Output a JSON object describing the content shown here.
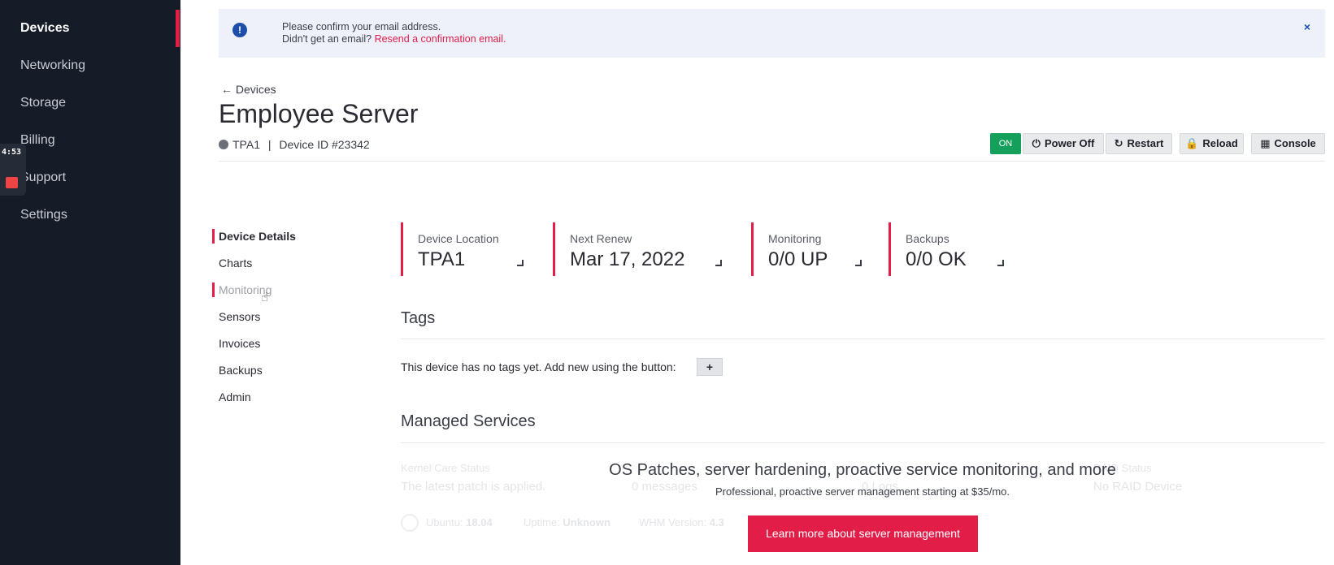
{
  "sidebar": {
    "items": [
      {
        "label": "Devices",
        "active": true
      },
      {
        "label": "Networking"
      },
      {
        "label": "Storage"
      },
      {
        "label": "Billing"
      },
      {
        "label": "Support"
      },
      {
        "label": "Settings"
      }
    ],
    "recording": {
      "time": "4:53"
    }
  },
  "alert": {
    "line1": "Please confirm your email address.",
    "line2_prefix": "Didn't get an email?",
    "link": "Resend a confirmation email.",
    "close": "×"
  },
  "header": {
    "back_label": "Devices",
    "title": "Employee Server",
    "location": "TPA1",
    "separator": "|",
    "device_id": "Device ID #23342"
  },
  "actions": {
    "on": "ON",
    "power_off": "Power Off",
    "restart": "Restart",
    "reload": "Reload",
    "console": "Console"
  },
  "subnav": [
    "Device Details",
    "Charts",
    "Monitoring",
    "Sensors",
    "Invoices",
    "Backups",
    "Admin"
  ],
  "stats": [
    {
      "label": "Device Location",
      "value": "TPA1"
    },
    {
      "label": "Next Renew",
      "value": "Mar 17, 2022"
    },
    {
      "label": "Monitoring",
      "value": "0/0 UP"
    },
    {
      "label": "Backups",
      "value": "0/0 OK"
    }
  ],
  "tags": {
    "title": "Tags",
    "empty_text": "This device has no tags yet. Add new using the button:",
    "add_label": "+"
  },
  "managed": {
    "title": "Managed Services",
    "ghost": {
      "kernel_label": "Kernel Care Status",
      "kernel_value": "The latest patch is applied.",
      "messages": "0 messages",
      "logs": "0 Logs",
      "raid_label": "RAID Status",
      "raid_value": "No RAID Device",
      "os_label": "Ubuntu:",
      "os_value": "18.04",
      "uptime_label": "Uptime:",
      "uptime_value": "Unknown",
      "whm_label": "WHM Version:",
      "whm_value": "4.3"
    },
    "promo_title": "OS Patches, server hardening, proactive service monitoring, and more",
    "promo_sub": "Professional, proactive server management starting at $35/mo.",
    "promo_button": "Learn more about server management"
  },
  "colors": {
    "accent": "#e11d48",
    "sidebar_bg": "#161b28",
    "on_green": "#14a05b",
    "alert_bg": "#eef1fa",
    "info_blue": "#1d4ea8"
  }
}
